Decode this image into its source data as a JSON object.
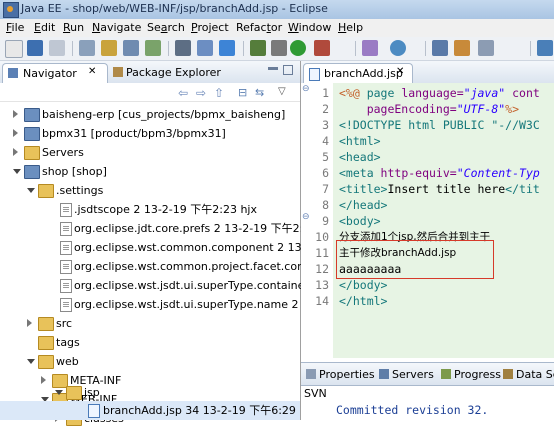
{
  "window": {
    "title": "Java EE - shop/web/WEB-INF/jsp/branchAdd.jsp - Eclipse"
  },
  "menu": [
    {
      "pre": "",
      "u": "F",
      "post": "ile"
    },
    {
      "pre": "",
      "u": "E",
      "post": "dit"
    },
    {
      "pre": "",
      "u": "R",
      "post": "un"
    },
    {
      "pre": "",
      "u": "N",
      "post": "avigate"
    },
    {
      "pre": "Se",
      "u": "a",
      "post": "rch"
    },
    {
      "pre": "",
      "u": "P",
      "post": "roject"
    },
    {
      "pre": "Refac",
      "u": "t",
      "post": "or"
    },
    {
      "pre": "",
      "u": "W",
      "post": "indow"
    },
    {
      "pre": "",
      "u": "H",
      "post": "elp"
    }
  ],
  "navigator": {
    "tabs": [
      "Navigator",
      "Package Explorer"
    ],
    "tree": [
      {
        "label": "baisheng-erp  [cus_projects/bpmx_baisheng]"
      },
      {
        "label": "bpmx31  [product/bpm3/bpmx31]"
      },
      {
        "label": "Servers"
      },
      {
        "label": "shop  [shop]"
      },
      {
        "label": ".settings"
      },
      {
        "label": ".jsdtscope  2  13-2-19 下午2:23  hjx"
      },
      {
        "label": "org.eclipse.jdt.core.prefs  2  13-2-19 下午2:2"
      },
      {
        "label": "org.eclipse.wst.common.component  2  13-2-19"
      },
      {
        "label": "org.eclipse.wst.common.project.facet.core.x"
      },
      {
        "label": "org.eclipse.wst.jsdt.ui.superType.container  2"
      },
      {
        "label": "org.eclipse.wst.jsdt.ui.superType.name  2  13-"
      },
      {
        "label": "src"
      },
      {
        "label": "tags"
      },
      {
        "label": "web"
      },
      {
        "label": "META-INF"
      },
      {
        "label": "WEB-INF"
      },
      {
        "label": "classes"
      },
      {
        "label": "jsp"
      },
      {
        "label": "branchAdd.jsp  34  13-2-19 下午6:29"
      }
    ]
  },
  "editor": {
    "tab": "branchAdd.jsp",
    "line_numbers": [
      "1",
      "2",
      "3",
      "4",
      "5",
      "6",
      "7",
      "8",
      "9",
      "10",
      "11",
      "12",
      "13",
      "14"
    ],
    "lines": {
      "l1a": "<%@ ",
      "l1b": "page ",
      "l1c": "language=",
      "l1d": "\"java\"",
      "l1e": " cont",
      "l2a": "    pageEncoding=",
      "l2b": "\"UTF-8\"",
      "l2c": "%>",
      "l3": "<!DOCTYPE html PUBLIC \"-//W3C",
      "l4": "<html>",
      "l5": "<head>",
      "l6a": "<meta ",
      "l6b": "http-equiv=",
      "l6c": "\"Content-Typ",
      "l7a": "<title>",
      "l7b": "Insert title here",
      "l7c": "</tit",
      "l8": "</head>",
      "l9": "<body>",
      "l10": "分支添加1个jsp,然后合并到主干",
      "l11": "主干修改branchAdd.jsp",
      "l12": "aaaaaaaaa",
      "l13": "</body>",
      "l14": "</html>"
    }
  },
  "bottom_panel": {
    "tabs": [
      "Properties",
      "Servers",
      "Progress",
      "Data Sc"
    ],
    "svn_label": "SVN",
    "message": "Committed revision 32."
  }
}
